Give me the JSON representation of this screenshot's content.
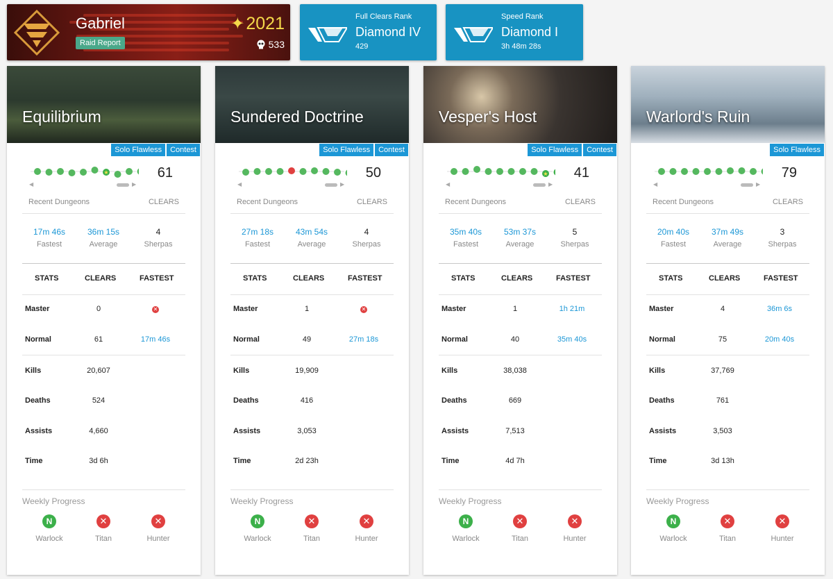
{
  "player": {
    "name": "Gabriel",
    "tag": "Raid Report",
    "power": "2021",
    "count": "533"
  },
  "ranks": [
    {
      "label": "Full Clears Rank",
      "tier": "Diamond IV",
      "sub": "429"
    },
    {
      "label": "Speed Rank",
      "tier": "Diamond I",
      "sub": "3h 48m 28s"
    }
  ],
  "labels": {
    "solo_flawless": "Solo Flawless",
    "contest": "Contest",
    "recent": "Recent Dungeons",
    "clears": "CLEARS",
    "fastest": "Fastest",
    "average": "Average",
    "sherpas": "Sherpas",
    "stats": "STATS",
    "clears_col": "CLEARS",
    "fastest_col": "FASTEST",
    "master": "Master",
    "normal": "Normal",
    "kills": "Kills",
    "deaths": "Deaths",
    "assists": "Assists",
    "time": "Time",
    "weekly": "Weekly Progress",
    "warlock": "Warlock",
    "titan": "Titan",
    "hunter": "Hunter",
    "n": "N",
    "x": "✕"
  },
  "cards": [
    {
      "title": "Equilibrium",
      "contest": true,
      "clears": "61",
      "fastest": "17m 46s",
      "average": "36m 15s",
      "sherpas": "4",
      "master_clears": "0",
      "master_fastest": "",
      "normal_clears": "61",
      "normal_fastest": "17m 46s",
      "kills": "20,607",
      "deaths": "524",
      "assists": "4,660",
      "time": "3d 6h",
      "dots": [
        "g",
        "g",
        "g",
        "g",
        "g",
        "g",
        "s",
        "g",
        "g",
        "g"
      ]
    },
    {
      "title": "Sundered Doctrine",
      "contest": true,
      "clears": "50",
      "fastest": "27m 18s",
      "average": "43m 54s",
      "sherpas": "4",
      "master_clears": "1",
      "master_fastest": "",
      "normal_clears": "49",
      "normal_fastest": "27m 18s",
      "kills": "19,909",
      "deaths": "416",
      "assists": "3,053",
      "time": "2d 23h",
      "dots": [
        "g",
        "g",
        "g",
        "g",
        "r",
        "g",
        "g",
        "g",
        "g",
        "g"
      ]
    },
    {
      "title": "Vesper's Host",
      "contest": true,
      "clears": "41",
      "fastest": "35m 40s",
      "average": "53m 37s",
      "sherpas": "5",
      "master_clears": "1",
      "master_fastest": "1h 21m",
      "normal_clears": "40",
      "normal_fastest": "35m 40s",
      "kills": "38,038",
      "deaths": "669",
      "assists": "7,513",
      "time": "4d 7h",
      "dots": [
        "g",
        "g",
        "g",
        "g",
        "g",
        "g",
        "g",
        "g",
        "s",
        "s"
      ]
    },
    {
      "title": "Warlord's Ruin",
      "contest": false,
      "clears": "79",
      "fastest": "20m 40s",
      "average": "37m 49s",
      "sherpas": "3",
      "master_clears": "4",
      "master_fastest": "36m 6s",
      "normal_clears": "75",
      "normal_fastest": "20m 40s",
      "kills": "37,769",
      "deaths": "761",
      "assists": "3,503",
      "time": "3d 13h",
      "dots": [
        "g",
        "g",
        "g",
        "g",
        "g",
        "g",
        "g",
        "g",
        "g",
        "g"
      ]
    }
  ],
  "colors": {
    "accent": "#1c97d6",
    "rank_bg": "#1893c2",
    "success": "#3cb04a",
    "fail": "#e04040"
  }
}
